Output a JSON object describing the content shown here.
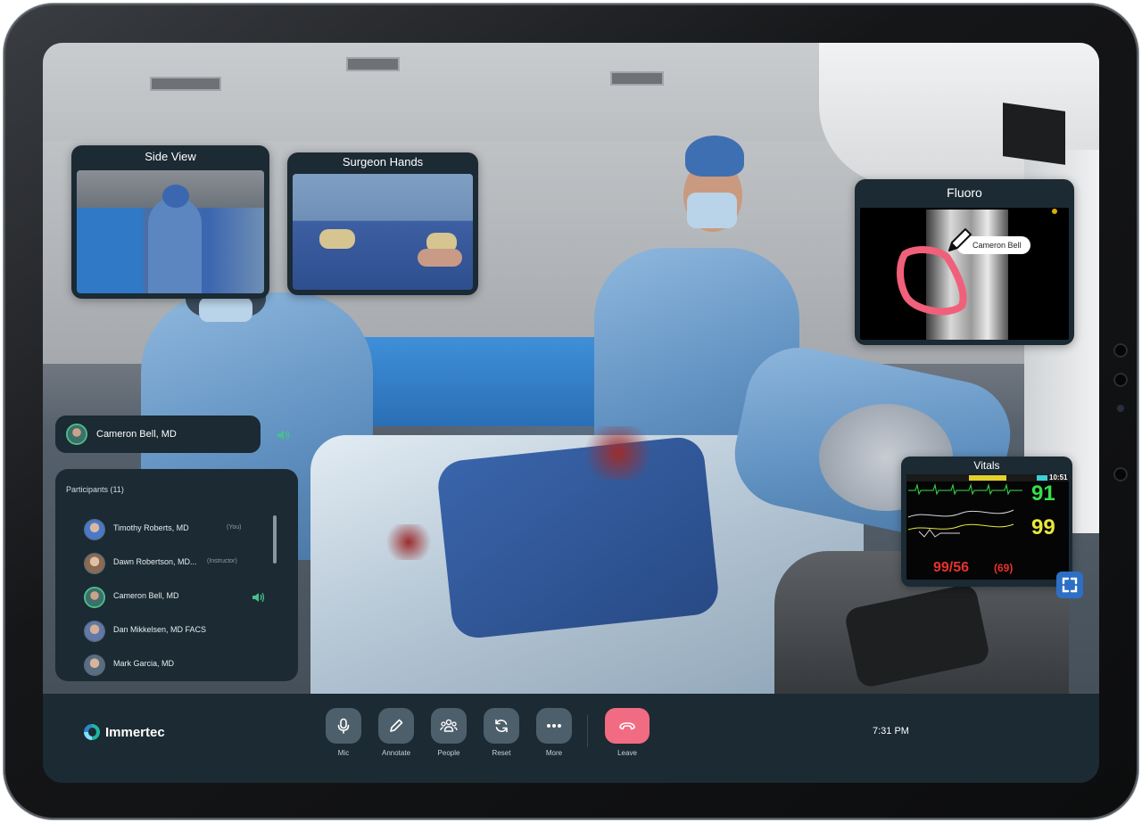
{
  "app": {
    "name": "Immertec",
    "time": "7:31 PM"
  },
  "feeds": {
    "side_view": {
      "title": "Side View"
    },
    "surgeon_hands": {
      "title": "Surgeon Hands"
    },
    "fluoro": {
      "title": "Fluoro",
      "annotation_author": "Cameron Bell",
      "annotation_color": "#f0607a"
    },
    "vitals": {
      "title": "Vitals",
      "clock": "10:51",
      "heart_rate": "91",
      "spo2": "99",
      "blood_pressure": "99/56",
      "mean_pressure": "(69)",
      "hr_color": "#36e04a",
      "spo2_color": "#e8e83a",
      "bp_color": "#e8322c"
    }
  },
  "active_speaker": {
    "name": "Cameron Bell, MD"
  },
  "participants": {
    "title": "Participants (11)",
    "list": [
      {
        "name": "Timothy Roberts, MD",
        "tag": "(You)",
        "speaking": false
      },
      {
        "name": "Dawn Robertson, MD...",
        "tag": "(Instructor)",
        "speaking": false
      },
      {
        "name": "Cameron Bell, MD",
        "tag": "",
        "speaking": true
      },
      {
        "name": "Dan Mikkelsen, MD FACS",
        "tag": "",
        "speaking": false
      },
      {
        "name": "Mark Garcia, MD",
        "tag": "",
        "speaking": false
      }
    ]
  },
  "toolbar": {
    "mic": "Mic",
    "annotate": "Annotate",
    "people": "People",
    "reset": "Reset",
    "more": "More",
    "leave": "Leave"
  },
  "colors": {
    "accent": "#47c08a",
    "leave": "#f16b82",
    "panel": "#1b2a33",
    "button": "#4d5f6b"
  }
}
